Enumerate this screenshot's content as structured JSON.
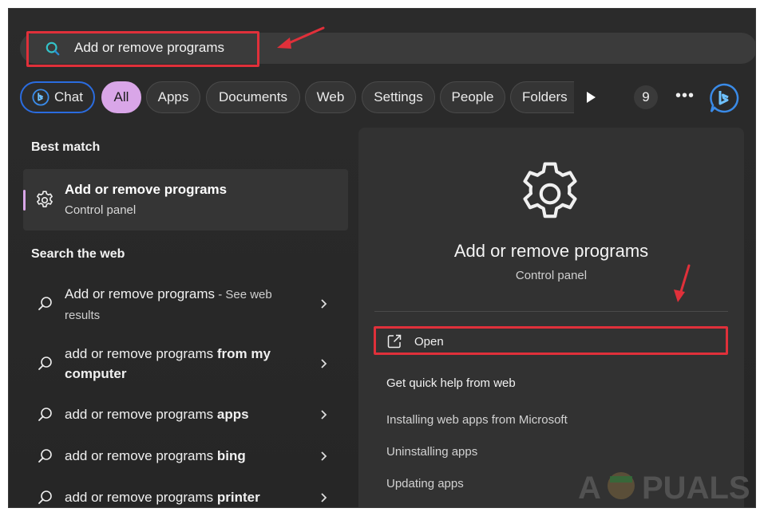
{
  "search": {
    "value": "Add or remove programs"
  },
  "filters": {
    "chips": [
      {
        "label": "Chat",
        "icon": "bing-icon"
      },
      {
        "label": "All"
      },
      {
        "label": "Apps"
      },
      {
        "label": "Documents"
      },
      {
        "label": "Web"
      },
      {
        "label": "Settings"
      },
      {
        "label": "People"
      },
      {
        "label": "Folders"
      }
    ],
    "count": "9"
  },
  "left": {
    "best_match_title": "Best match",
    "best_match": {
      "title": "Add or remove programs",
      "subtitle": "Control panel",
      "icon": "gear-icon"
    },
    "search_web_title": "Search the web",
    "web_results": [
      {
        "prefix": "Add or remove programs",
        "bold": "",
        "suffix": " - See web results"
      },
      {
        "prefix": "add or remove programs ",
        "bold": "from my computer",
        "suffix": ""
      },
      {
        "prefix": "add or remove programs ",
        "bold": "apps",
        "suffix": ""
      },
      {
        "prefix": "add or remove programs ",
        "bold": "bing",
        "suffix": ""
      },
      {
        "prefix": "add or remove programs ",
        "bold": "printer",
        "suffix": ""
      }
    ]
  },
  "right": {
    "title": "Add or remove programs",
    "subtitle": "Control panel",
    "open_label": "Open",
    "quick_help_title": "Get quick help from web",
    "links": [
      "Installing web apps from Microsoft",
      "Uninstalling apps",
      "Updating apps"
    ]
  },
  "watermark": {
    "text": "A PUALS"
  },
  "colors": {
    "accent_pink": "#d9a6e8",
    "chat_border": "#2a6ce0",
    "annotation_red": "#e0303a",
    "background": "#2b2b2b"
  }
}
